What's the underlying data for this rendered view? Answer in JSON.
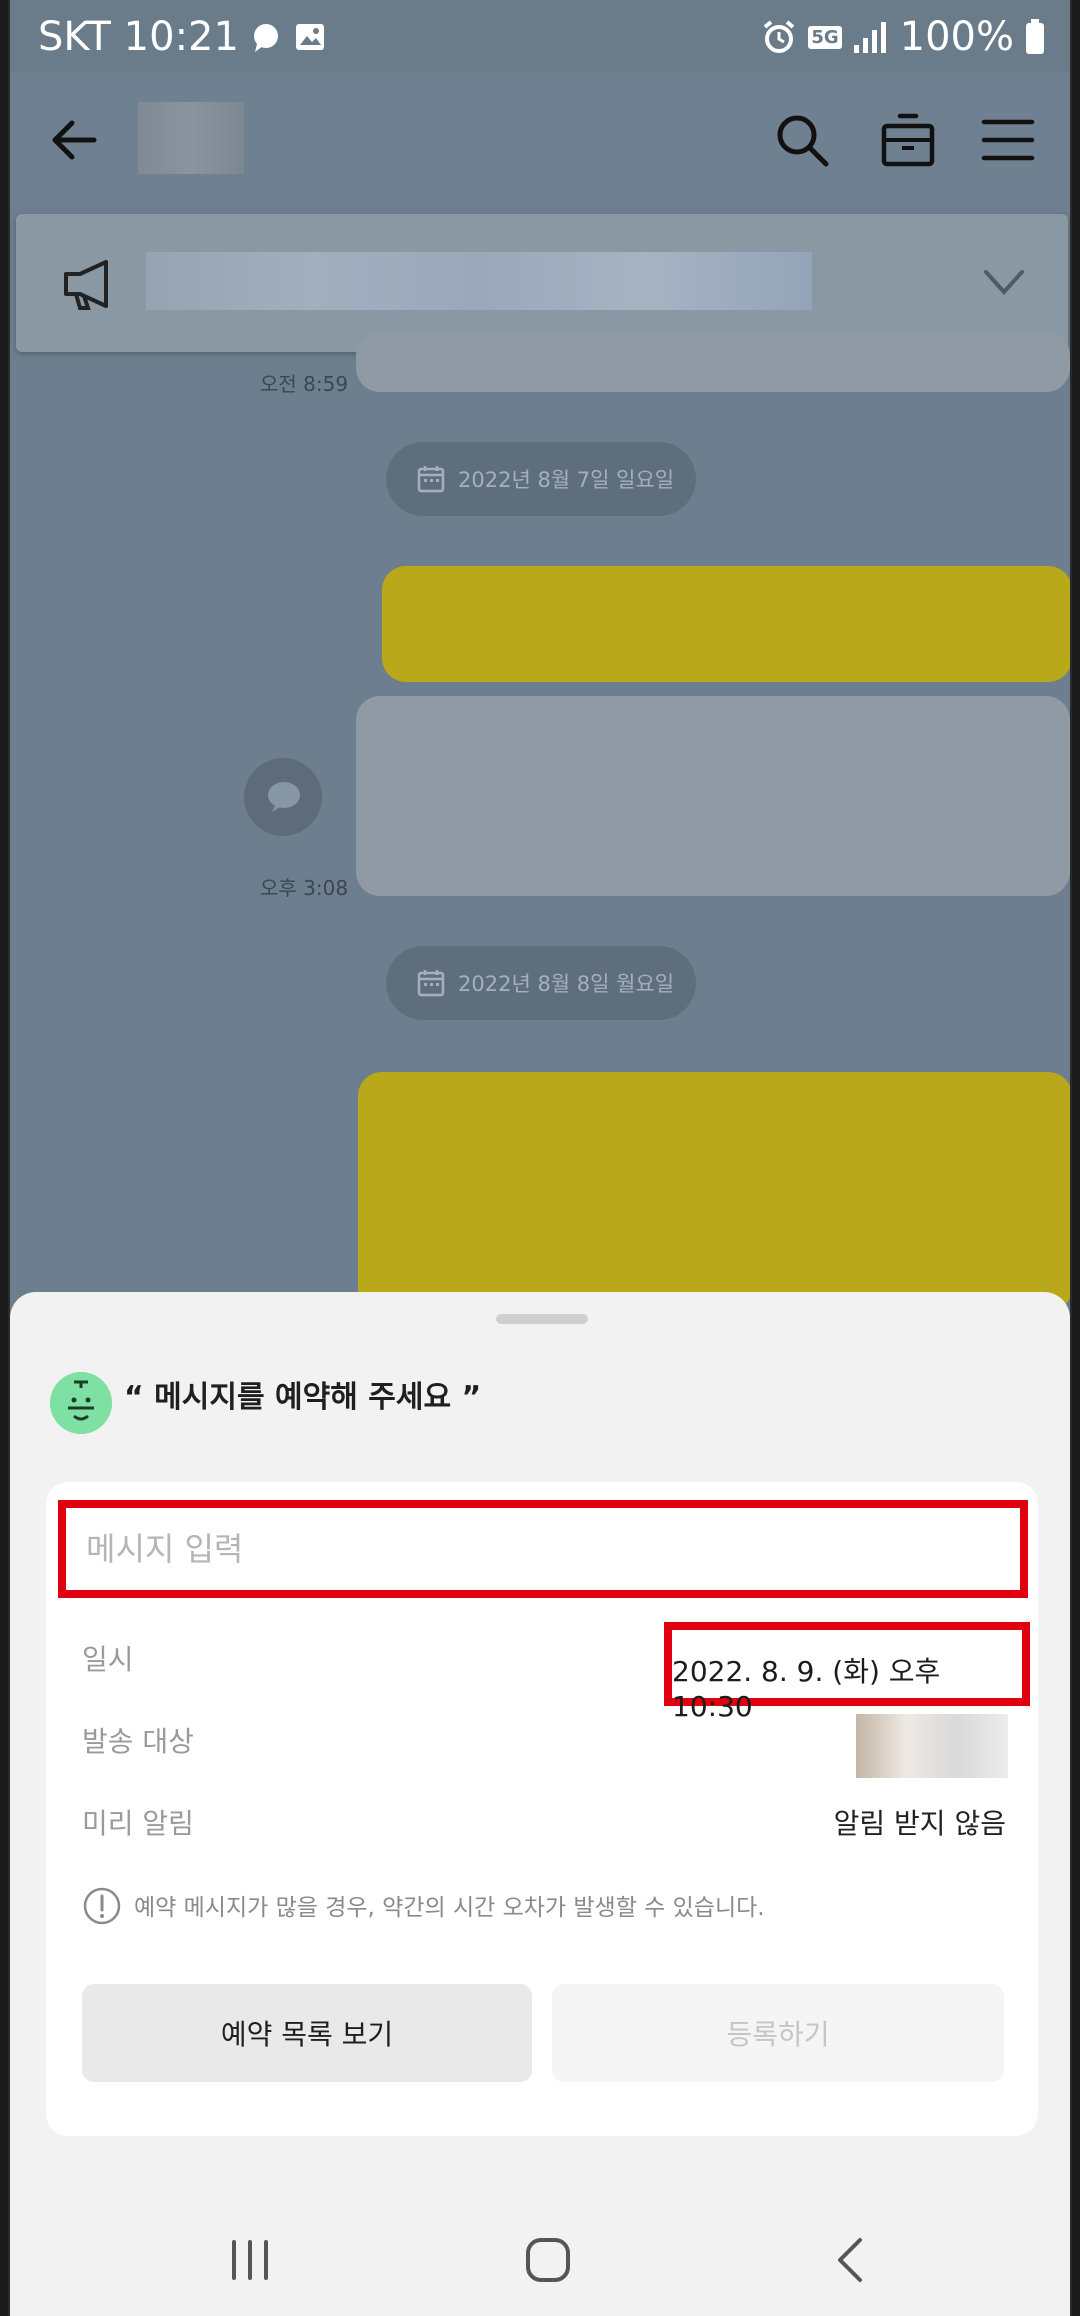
{
  "status_bar": {
    "carrier_time": "SKT 10:21",
    "network": "5G",
    "battery": "100%"
  },
  "chat": {
    "time_1": "오전 8:59",
    "date_1": "2022년 8월 7일 일요일",
    "time_2": "오후 3:08",
    "date_2": "2022년 8월 8일 월요일"
  },
  "sheet": {
    "prompt": "“ 메시지를 예약해 주세요 ”",
    "message_placeholder": "메시지 입력",
    "datetime_label": "일시",
    "datetime_value": "2022. 8. 9. (화) 오후 10:30",
    "target_label": "발송 대상",
    "reminder_label": "미리 알림",
    "reminder_value": "알림 받지 않음",
    "warning": "예약 메시지가 많을 경우, 약간의 시간 오차가 발생할 수 있습니다.",
    "list_button": "예약 목록 보기",
    "register_button": "등록하기"
  },
  "colors": {
    "highlight": "#e0000f",
    "bot_icon": "#7ee0a2",
    "outgoing_bubble": "#b9a91a"
  }
}
